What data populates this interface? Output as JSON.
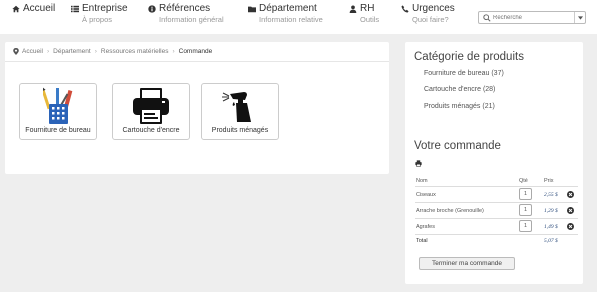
{
  "nav": {
    "accueil": "Accueil",
    "entreprise": {
      "title": "Entreprise",
      "sub": "À propos"
    },
    "references": {
      "title": "Références",
      "sub": "Information général"
    },
    "departement": {
      "title": "Département",
      "sub": "Information relative"
    },
    "rh": {
      "title": "RH",
      "sub": "Outils"
    },
    "urgences": {
      "title": "Urgences",
      "sub": "Quoi faire?"
    },
    "search_placeholder": "Recherche"
  },
  "breadcrumb": [
    "Accueil",
    "Département",
    "Ressources matérielles",
    "Commande"
  ],
  "tiles": [
    {
      "label": "Fourniture de bureau",
      "icon": "pencil-cup-icon"
    },
    {
      "label": "Cartouche d'encre",
      "icon": "printer-icon"
    },
    {
      "label": "Produits ménagés",
      "icon": "spray-bottle-icon"
    }
  ],
  "categories": {
    "title": "Catégorie de produits",
    "items": [
      {
        "label": "Fourniture de bureau",
        "count": "(37)"
      },
      {
        "label": "Cartouche d'encre",
        "count": "(28)"
      },
      {
        "label": "Produits ménagés",
        "count": "(21)"
      }
    ]
  },
  "order": {
    "title": "Votre commande",
    "headers": {
      "name": "Nom",
      "qty": "Qté",
      "price": "Prix"
    },
    "items": [
      {
        "name": "Ciseaux",
        "qty": "1",
        "price": "2,55 $"
      },
      {
        "name": "Arrache broche (Grenouille)",
        "qty": "1",
        "price": "1,29 $"
      },
      {
        "name": "Agrafes",
        "qty": "1",
        "price": "1,49 $"
      }
    ],
    "total_label": "Total",
    "total_value": "5,07 $",
    "finish_label": "Terminer ma commande"
  },
  "colors": {
    "page_bg": "#eeeeee",
    "panel_bg": "#ffffff",
    "price": "#2a4a7a"
  }
}
